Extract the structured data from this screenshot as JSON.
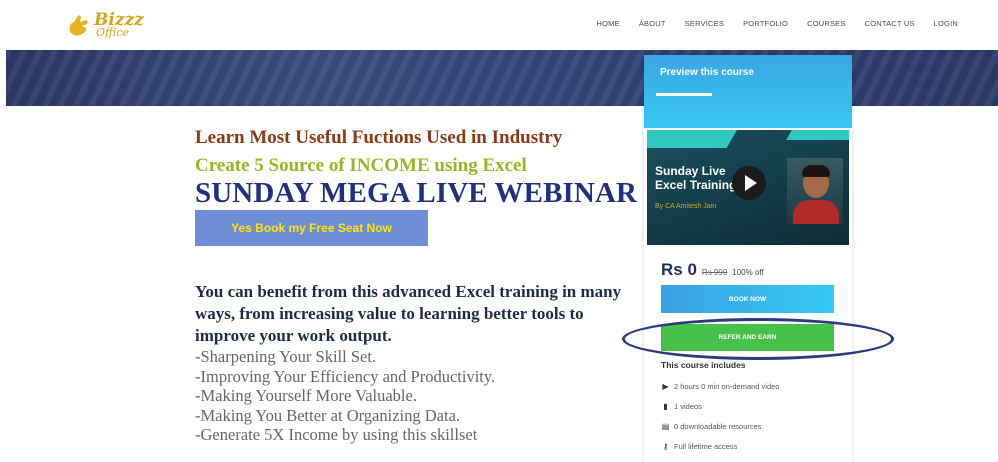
{
  "logo": {
    "text": "Bizzz",
    "sub": "Office"
  },
  "nav": [
    "HOME",
    "ABOUT",
    "SERVICES",
    "PORTFOLIO",
    "COURSES",
    "CONTACT US",
    "LOGIN"
  ],
  "hero": {
    "line1": "Learn Most Useful Fuctions Used in Industry",
    "line2": "Create 5 Source of INCOME using Excel",
    "line3": "SUNDAY MEGA LIVE WEBINAR",
    "cta": "Yes Book my Free Seat Now"
  },
  "benefit": "You can benefit from this advanced Excel training in many ways, from increasing value to learning better tools to improve your work output.",
  "points": [
    "-Sharpening Your Skill Set.",
    "-Improving Your Efficiency and Productivity.",
    "-Making Yourself More Valuable.",
    "-Making You Better at Organizing Data.",
    "-Generate 5X Income by using this skillset"
  ],
  "card": {
    "preview_title": "Preview this course",
    "video_title": "Sunday Live Excel Training",
    "video_by": "By CA Amitesh Jain",
    "price": "Rs 0",
    "old_price": "Rs 999",
    "discount": "100% off",
    "book_now": "BOOK NOW",
    "refer": "REFER AND EARN",
    "includes_title": "This course includes",
    "includes": [
      {
        "icon": "play-circle-icon",
        "text": "2 hours 0 min on-demand video"
      },
      {
        "icon": "file-icon",
        "text": "1 videos"
      },
      {
        "icon": "document-icon",
        "text": "0 downloadable resources"
      },
      {
        "icon": "key-icon",
        "text": "Full lifetime access"
      }
    ]
  },
  "colors": {
    "accent_blue": "#3aa6e4",
    "refer_green": "#46c14a",
    "heading_navy": "#1f2f82",
    "oval_annotation": "#2a3a80"
  }
}
